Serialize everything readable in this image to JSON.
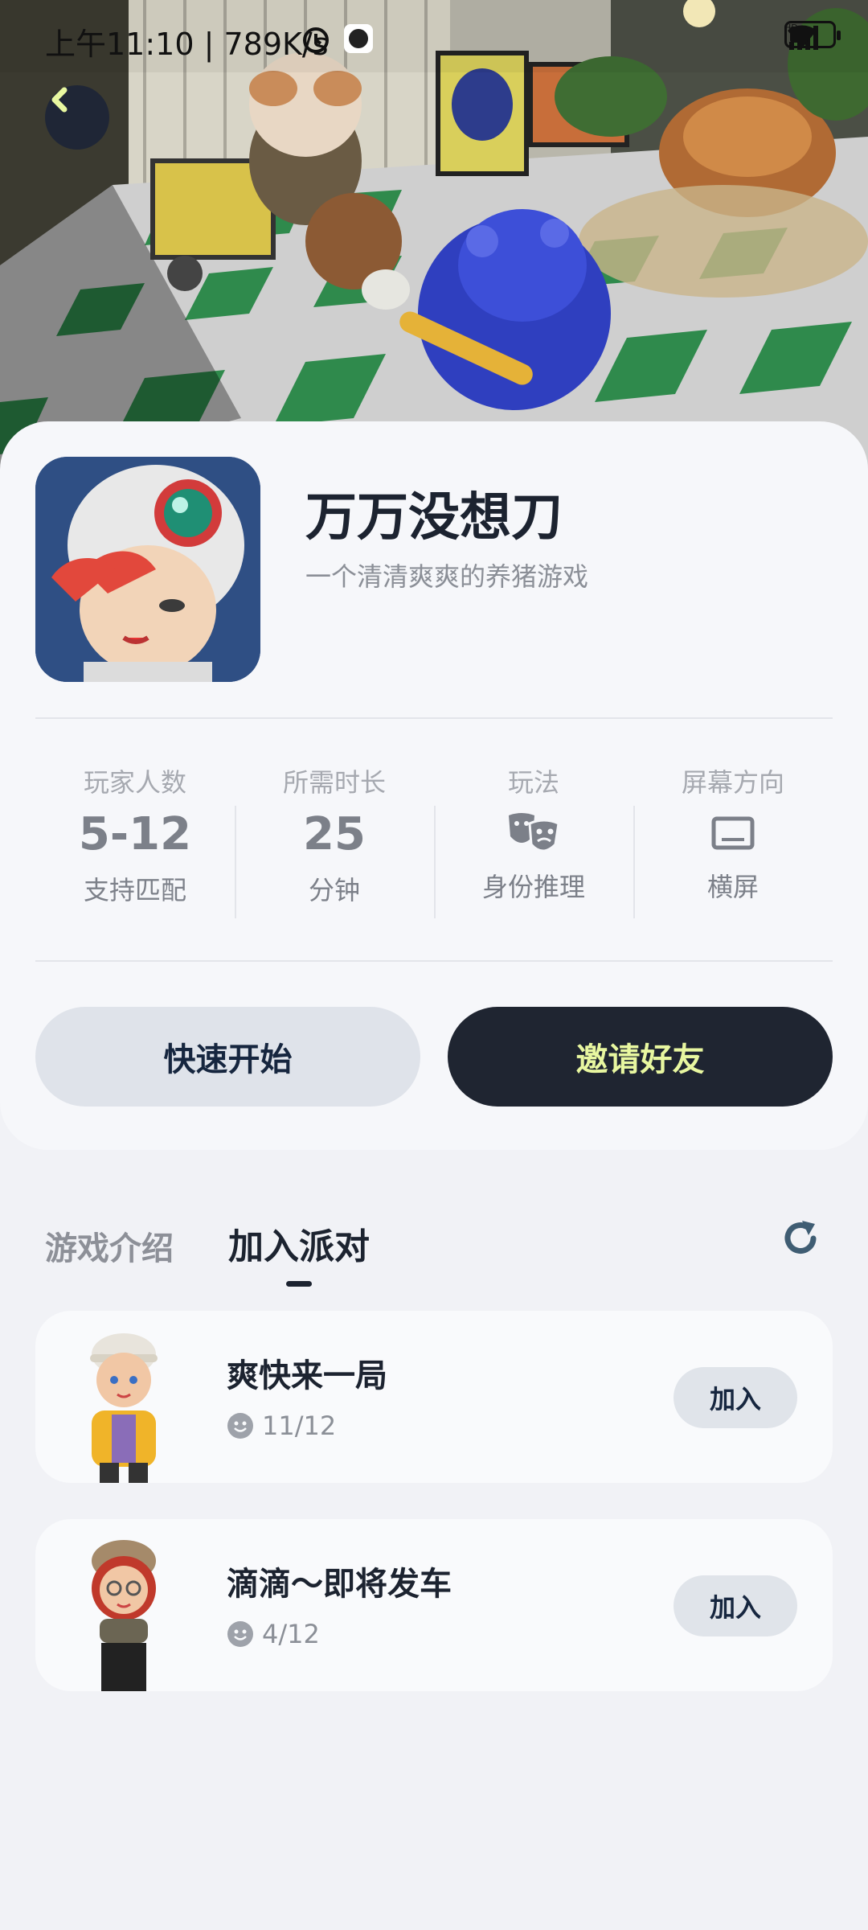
{
  "status": {
    "time": "上午11:10 | 789K/s",
    "hd": "HD"
  },
  "game": {
    "title": "万万没想刀",
    "subtitle": "一个清清爽爽的养猪游戏"
  },
  "stats": [
    {
      "label": "玩家人数",
      "value": "5-12",
      "sub": "支持匹配"
    },
    {
      "label": "所需时长",
      "value": "25",
      "sub": "分钟"
    },
    {
      "label": "玩法",
      "icon": "drama-masks-icon",
      "sub": "身份推理"
    },
    {
      "label": "屏幕方向",
      "icon": "screen-landscape-icon",
      "sub": "横屏"
    }
  ],
  "buttons": {
    "quick_start": "快速开始",
    "invite": "邀请好友"
  },
  "tabs": {
    "intro": "游戏介绍",
    "party": "加入派对"
  },
  "rooms": [
    {
      "name": "爽快来一局",
      "count": "11/12",
      "join": "加入"
    },
    {
      "name": "滴滴～即将发车",
      "count": "4/12",
      "join": "加入"
    }
  ],
  "colors": {
    "accent_dark": "#1f2531",
    "invite_text": "#e8f7a0",
    "page_bg": "#f1f2f6"
  }
}
